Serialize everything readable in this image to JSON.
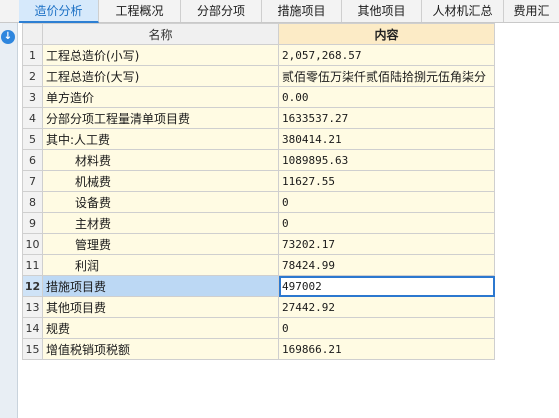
{
  "tabs": [
    {
      "label": "造价分析",
      "active": true
    },
    {
      "label": "工程概况",
      "active": false
    },
    {
      "label": "分部分项",
      "active": false
    },
    {
      "label": "措施项目",
      "active": false
    },
    {
      "label": "其他项目",
      "active": false
    },
    {
      "label": "人材机汇总",
      "active": false
    },
    {
      "label": "费用汇",
      "active": false
    }
  ],
  "table": {
    "headers": {
      "name": "名称",
      "content": "内容"
    },
    "rows": [
      {
        "no": "1",
        "name": "工程总造价(小写)",
        "value": "2,057,268.57"
      },
      {
        "no": "2",
        "name": "工程总造价(大写)",
        "value": "贰佰零伍万柒仟贰佰陆拾捌元伍角柒分"
      },
      {
        "no": "3",
        "name": "单方造价",
        "value": "0.00"
      },
      {
        "no": "4",
        "name": "分部分项工程量清单项目费",
        "value": "1633537.27"
      },
      {
        "no": "5",
        "name": "其中:人工费",
        "value": "380414.21"
      },
      {
        "no": "6",
        "name": "材料费",
        "value": "1089895.63"
      },
      {
        "no": "7",
        "name": "机械费",
        "value": "11627.55"
      },
      {
        "no": "8",
        "name": "设备费",
        "value": "0"
      },
      {
        "no": "9",
        "name": "主材费",
        "value": "0"
      },
      {
        "no": "10",
        "name": "管理费",
        "value": "73202.17"
      },
      {
        "no": "11",
        "name": "利润",
        "value": "78424.99"
      },
      {
        "no": "12",
        "name": "措施项目费",
        "value": "497002"
      },
      {
        "no": "13",
        "name": "其他项目费",
        "value": "27442.92"
      },
      {
        "no": "14",
        "name": "规费",
        "value": "0"
      },
      {
        "no": "15",
        "name": "增值税销项税额",
        "value": "169866.21"
      }
    ],
    "selected_row": "12"
  },
  "icons": {
    "collapse": "circle-arrow-down-icon"
  },
  "colors": {
    "accent": "#2d7fd3",
    "content_header": "#fcebc6",
    "cell_background": "#fffbe3",
    "selected_row": "#bcd8f4"
  }
}
